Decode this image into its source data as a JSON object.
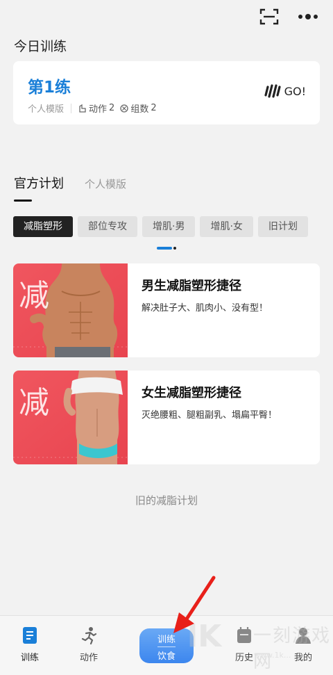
{
  "header": {
    "scan_icon": "scan-icon",
    "more_icon": "more-dots-icon"
  },
  "today": {
    "section_title": "今日训练",
    "card": {
      "name": "第1练",
      "template": "个人模版",
      "actions_label": "动作",
      "actions_count": "2",
      "sets_label": "组数",
      "sets_count": "2",
      "go_label": "GO!"
    }
  },
  "plan_tabs": {
    "active": "官方计划",
    "inactive": "个人模版"
  },
  "chips": [
    "减脂塑形",
    "部位专攻",
    "增肌·男",
    "增肌·女",
    "旧计划"
  ],
  "plans": [
    {
      "badge": "减",
      "title": "男生减脂塑形捷径",
      "desc": "解决肚子大、肌肉小、没有型！"
    },
    {
      "badge": "减",
      "title": "女生减脂塑形捷径",
      "desc": "灭绝腰粗、腿粗副乳、塌扁平臀！"
    }
  ],
  "old_plans_link": "旧的减脂计划",
  "tabbar": {
    "train": "训练",
    "action": "动作",
    "center_top": "训练",
    "center_bottom": "饮食",
    "history": "历史",
    "mine": "我的"
  },
  "watermark": {
    "text": "一刻游戏网",
    "url": "www.1k..."
  },
  "colors": {
    "accent": "#1a7fd8",
    "card_red": "#ef5a63",
    "annotation_arrow": "#e8201a"
  }
}
